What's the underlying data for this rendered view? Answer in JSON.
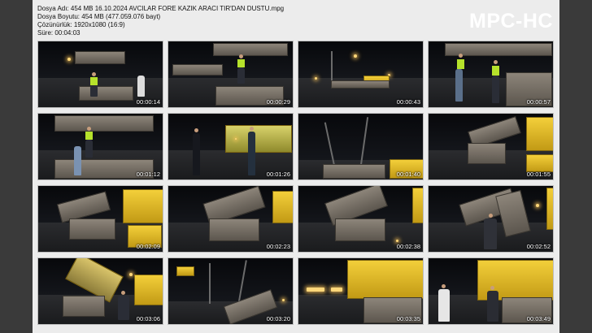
{
  "info": {
    "filename": "Dosya Adı: 454 MB 16.10.2024 AVCILAR FORE KAZIK ARACI TIR'DAN DUSTU.mpg",
    "filesize": "Dosya Boyutu: 454 MB (477.059.076 bayt)",
    "resolution": "Çözünürlük: 1920x1080 (16:9)",
    "duration": "Süre: 00:04:03"
  },
  "logo": "MPC-HC",
  "thumbnails": [
    {
      "time": "00:00:14",
      "scene": "pile-blocks-workers"
    },
    {
      "time": "00:00:29",
      "scene": "pile-blocks-worker"
    },
    {
      "time": "00:00:43",
      "scene": "night-road-lights"
    },
    {
      "time": "00:00:57",
      "scene": "workers-close"
    },
    {
      "time": "00:01:12",
      "scene": "blocks-two-workers"
    },
    {
      "time": "00:01:26",
      "scene": "police-officers"
    },
    {
      "time": "00:01:40",
      "scene": "crane-cables"
    },
    {
      "time": "00:01:55",
      "scene": "overturned-machine"
    },
    {
      "time": "00:02:09",
      "scene": "overturned-machine"
    },
    {
      "time": "00:02:23",
      "scene": "overturned-machine"
    },
    {
      "time": "00:02:38",
      "scene": "overturned-machine"
    },
    {
      "time": "00:02:52",
      "scene": "overturned-with-person"
    },
    {
      "time": "00:03:06",
      "scene": "overturned-yellow"
    },
    {
      "time": "00:03:20",
      "scene": "dark-crane"
    },
    {
      "time": "00:03:35",
      "scene": "yellow-machinery"
    },
    {
      "time": "00:03:49",
      "scene": "yellow-machinery-people"
    }
  ]
}
